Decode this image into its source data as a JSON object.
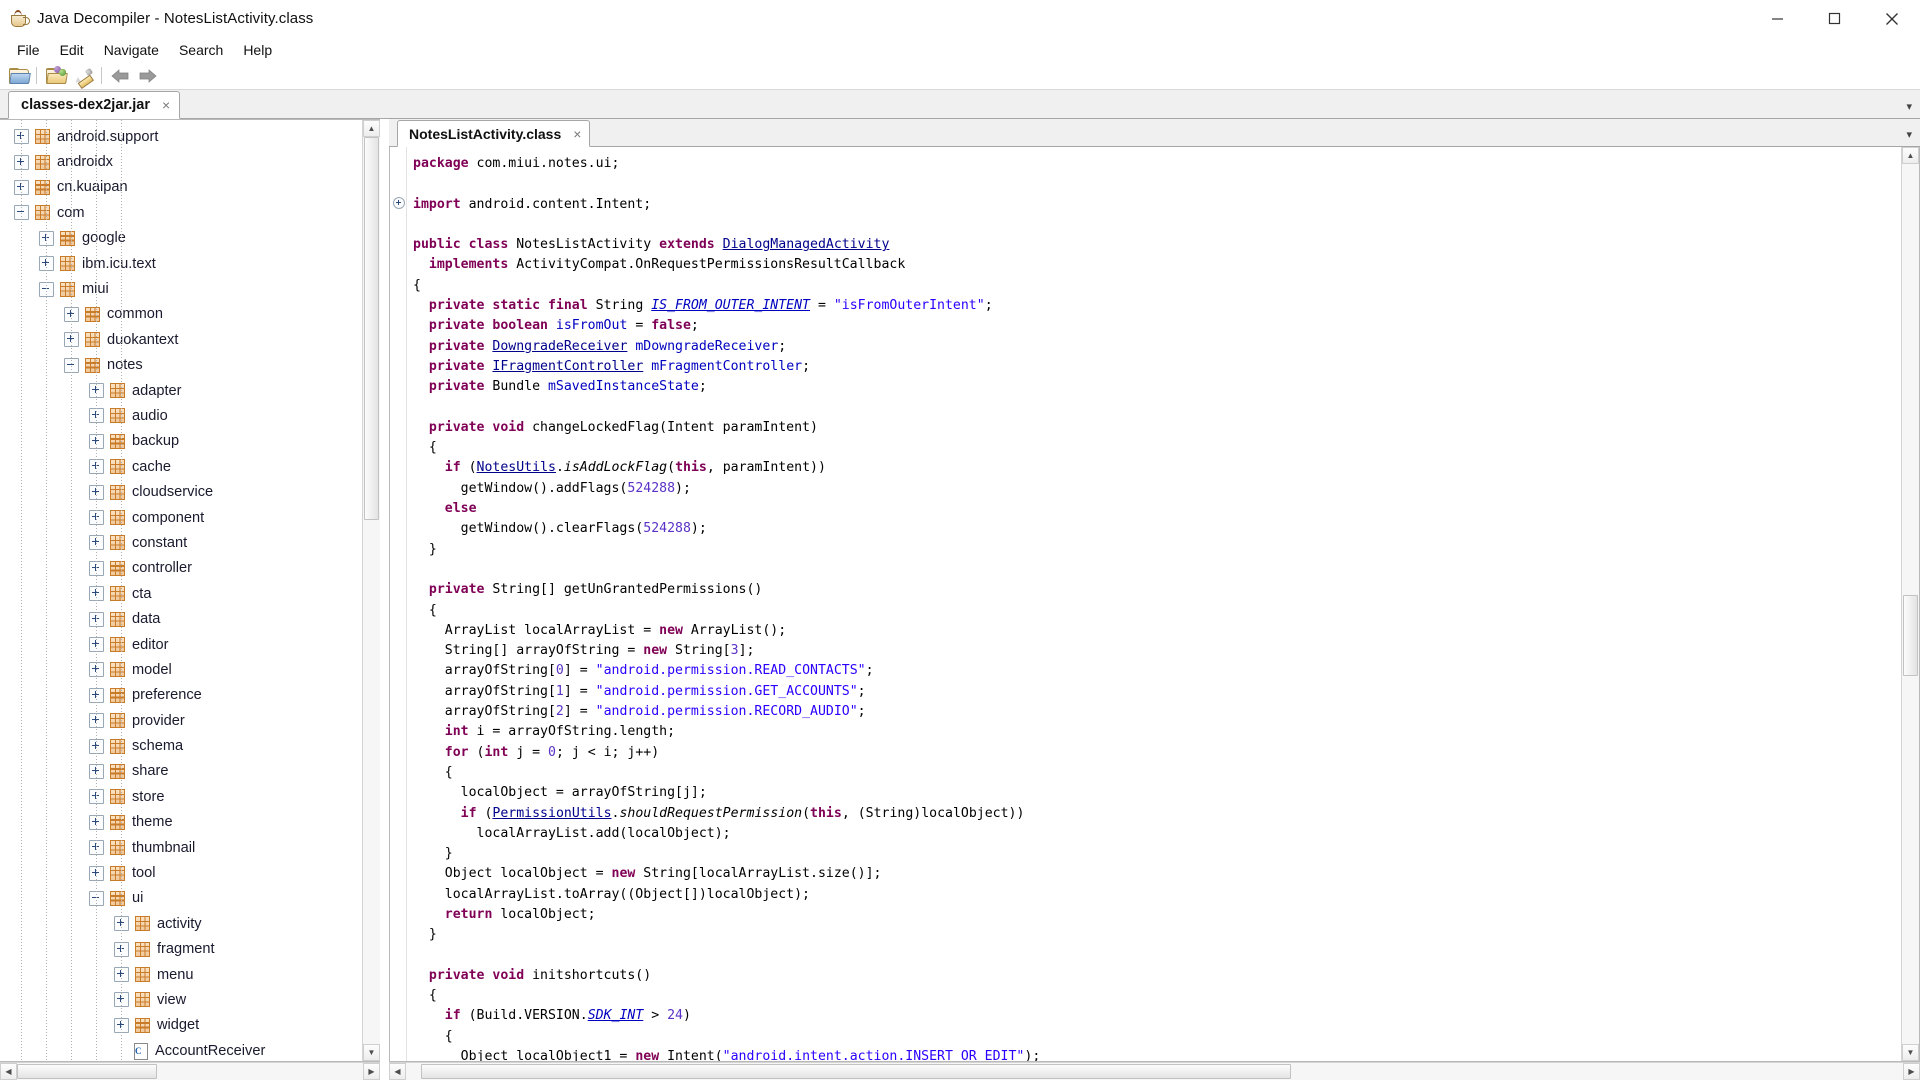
{
  "window": {
    "title": "Java Decompiler - NotesListActivity.class",
    "icon": "java-cup-icon",
    "controls": {
      "minimize": "minimize-button",
      "maximize": "maximize-button",
      "close": "close-button"
    }
  },
  "menu": {
    "items": [
      "File",
      "Edit",
      "Navigate",
      "Search",
      "Help"
    ]
  },
  "toolbar": {
    "buttons": [
      {
        "name": "open-file-icon",
        "tooltip": "Open File"
      },
      {
        "name": "open-type-icon",
        "tooltip": "Open Type"
      },
      {
        "name": "search-pencil-icon",
        "tooltip": "Open Type Hierarchy"
      },
      {
        "name": "back-arrow-icon",
        "tooltip": "Back"
      },
      {
        "name": "forward-arrow-icon",
        "tooltip": "Forward"
      }
    ]
  },
  "jar_tab": {
    "label": "classes-dex2jar.jar",
    "close": "×",
    "strip_arrow": "▾"
  },
  "tree": {
    "nodes": [
      {
        "label": "android.support",
        "depth": 0,
        "state": "collapsed",
        "icon": "package-icon"
      },
      {
        "label": "androidx",
        "depth": 0,
        "state": "collapsed",
        "icon": "package-icon"
      },
      {
        "label": "cn.kuaipan",
        "depth": 0,
        "state": "collapsed",
        "icon": "package-icon"
      },
      {
        "label": "com",
        "depth": 0,
        "state": "expanded",
        "icon": "package-icon"
      },
      {
        "label": "google",
        "depth": 1,
        "state": "collapsed",
        "icon": "package-icon"
      },
      {
        "label": "ibm.icu.text",
        "depth": 1,
        "state": "collapsed",
        "icon": "package-icon"
      },
      {
        "label": "miui",
        "depth": 1,
        "state": "expanded",
        "icon": "package-icon"
      },
      {
        "label": "common",
        "depth": 2,
        "state": "collapsed",
        "icon": "package-icon"
      },
      {
        "label": "duokantext",
        "depth": 2,
        "state": "collapsed",
        "icon": "package-icon"
      },
      {
        "label": "notes",
        "depth": 2,
        "state": "expanded",
        "icon": "package-icon"
      },
      {
        "label": "adapter",
        "depth": 3,
        "state": "collapsed",
        "icon": "package-icon"
      },
      {
        "label": "audio",
        "depth": 3,
        "state": "collapsed",
        "icon": "package-icon"
      },
      {
        "label": "backup",
        "depth": 3,
        "state": "collapsed",
        "icon": "package-icon"
      },
      {
        "label": "cache",
        "depth": 3,
        "state": "collapsed",
        "icon": "package-icon"
      },
      {
        "label": "cloudservice",
        "depth": 3,
        "state": "collapsed",
        "icon": "package-icon"
      },
      {
        "label": "component",
        "depth": 3,
        "state": "collapsed",
        "icon": "package-icon"
      },
      {
        "label": "constant",
        "depth": 3,
        "state": "collapsed",
        "icon": "package-icon"
      },
      {
        "label": "controller",
        "depth": 3,
        "state": "collapsed",
        "icon": "package-icon"
      },
      {
        "label": "cta",
        "depth": 3,
        "state": "collapsed",
        "icon": "package-icon"
      },
      {
        "label": "data",
        "depth": 3,
        "state": "collapsed",
        "icon": "package-icon"
      },
      {
        "label": "editor",
        "depth": 3,
        "state": "collapsed",
        "icon": "package-icon"
      },
      {
        "label": "model",
        "depth": 3,
        "state": "collapsed",
        "icon": "package-icon"
      },
      {
        "label": "preference",
        "depth": 3,
        "state": "collapsed",
        "icon": "package-icon"
      },
      {
        "label": "provider",
        "depth": 3,
        "state": "collapsed",
        "icon": "package-icon"
      },
      {
        "label": "schema",
        "depth": 3,
        "state": "collapsed",
        "icon": "package-icon"
      },
      {
        "label": "share",
        "depth": 3,
        "state": "collapsed",
        "icon": "package-icon"
      },
      {
        "label": "store",
        "depth": 3,
        "state": "collapsed",
        "icon": "package-icon"
      },
      {
        "label": "theme",
        "depth": 3,
        "state": "collapsed",
        "icon": "package-icon"
      },
      {
        "label": "thumbnail",
        "depth": 3,
        "state": "collapsed",
        "icon": "package-icon"
      },
      {
        "label": "tool",
        "depth": 3,
        "state": "collapsed",
        "icon": "package-icon"
      },
      {
        "label": "ui",
        "depth": 3,
        "state": "expanded",
        "icon": "package-icon"
      },
      {
        "label": "activity",
        "depth": 4,
        "state": "collapsed",
        "icon": "package-icon"
      },
      {
        "label": "fragment",
        "depth": 4,
        "state": "collapsed",
        "icon": "package-icon"
      },
      {
        "label": "menu",
        "depth": 4,
        "state": "collapsed",
        "icon": "package-icon"
      },
      {
        "label": "view",
        "depth": 4,
        "state": "collapsed",
        "icon": "package-icon"
      },
      {
        "label": "widget",
        "depth": 4,
        "state": "collapsed",
        "icon": "package-icon"
      },
      {
        "label": "AccountReceiver",
        "depth": 4,
        "state": "leaf",
        "icon": "class-file-icon"
      }
    ]
  },
  "code_tab": {
    "label": "NotesListActivity.class",
    "close": "×",
    "strip_arrow": "▾"
  },
  "code": {
    "language": "java",
    "lines": [
      [
        {
          "t": "package ",
          "c": "k"
        },
        {
          "t": "com.miui.notes.ui;",
          "c": ""
        }
      ],
      [],
      [
        {
          "t": "import ",
          "c": "k"
        },
        {
          "t": "android.content.Intent;",
          "c": ""
        }
      ],
      [],
      [
        {
          "t": "public class ",
          "c": "k"
        },
        {
          "t": "NotesListActivity ",
          "c": ""
        },
        {
          "t": "extends ",
          "c": "k"
        },
        {
          "t": "DialogManagedActivity",
          "c": "t"
        }
      ],
      [
        {
          "t": "  implements ",
          "c": "k"
        },
        {
          "t": "ActivityCompat.OnRequestPermissionsResultCallback",
          "c": ""
        }
      ],
      [
        {
          "t": "{",
          "c": ""
        }
      ],
      [
        {
          "t": "  private static final ",
          "c": "k"
        },
        {
          "t": "String ",
          "c": ""
        },
        {
          "t": "IS_FROM_OUTER_INTENT",
          "c": "sf"
        },
        {
          "t": " = ",
          "c": ""
        },
        {
          "t": "\"isFromOuterIntent\"",
          "c": "s"
        },
        {
          "t": ";",
          "c": ""
        }
      ],
      [
        {
          "t": "  private boolean ",
          "c": "k"
        },
        {
          "t": "isFromOut",
          "c": "f"
        },
        {
          "t": " = ",
          "c": ""
        },
        {
          "t": "false",
          "c": "k"
        },
        {
          "t": ";",
          "c": ""
        }
      ],
      [
        {
          "t": "  private ",
          "c": "k"
        },
        {
          "t": "DowngradeReceiver",
          "c": "t"
        },
        {
          "t": " ",
          "c": ""
        },
        {
          "t": "mDowngradeReceiver",
          "c": "f"
        },
        {
          "t": ";",
          "c": ""
        }
      ],
      [
        {
          "t": "  private ",
          "c": "k"
        },
        {
          "t": "IFragmentController",
          "c": "t"
        },
        {
          "t": " ",
          "c": ""
        },
        {
          "t": "mFragmentController",
          "c": "f"
        },
        {
          "t": ";",
          "c": ""
        }
      ],
      [
        {
          "t": "  private ",
          "c": "k"
        },
        {
          "t": "Bundle ",
          "c": ""
        },
        {
          "t": "mSavedInstanceState",
          "c": "f"
        },
        {
          "t": ";",
          "c": ""
        }
      ],
      [],
      [
        {
          "t": "  private void ",
          "c": "k"
        },
        {
          "t": "changeLockedFlag(Intent paramIntent)",
          "c": ""
        }
      ],
      [
        {
          "t": "  {",
          "c": ""
        }
      ],
      [
        {
          "t": "    ",
          "c": ""
        },
        {
          "t": "if",
          "c": "k"
        },
        {
          "t": " (",
          "c": ""
        },
        {
          "t": "NotesUtils",
          "c": "t"
        },
        {
          "t": ".",
          "c": ""
        },
        {
          "t": "isAddLockFlag",
          "c": "m"
        },
        {
          "t": "(",
          "c": ""
        },
        {
          "t": "this",
          "c": "k"
        },
        {
          "t": ", paramIntent))",
          "c": ""
        }
      ],
      [
        {
          "t": "      getWindow().addFlags(",
          "c": ""
        },
        {
          "t": "524288",
          "c": "n"
        },
        {
          "t": ");",
          "c": ""
        }
      ],
      [
        {
          "t": "    ",
          "c": ""
        },
        {
          "t": "else",
          "c": "k"
        }
      ],
      [
        {
          "t": "      getWindow().clearFlags(",
          "c": ""
        },
        {
          "t": "524288",
          "c": "n"
        },
        {
          "t": ");",
          "c": ""
        }
      ],
      [
        {
          "t": "  }",
          "c": ""
        }
      ],
      [],
      [
        {
          "t": "  private ",
          "c": "k"
        },
        {
          "t": "String[] getUnGrantedPermissions()",
          "c": ""
        }
      ],
      [
        {
          "t": "  {",
          "c": ""
        }
      ],
      [
        {
          "t": "    ArrayList localArrayList = ",
          "c": ""
        },
        {
          "t": "new",
          "c": "k"
        },
        {
          "t": " ArrayList();",
          "c": ""
        }
      ],
      [
        {
          "t": "    String[] arrayOfString = ",
          "c": ""
        },
        {
          "t": "new",
          "c": "k"
        },
        {
          "t": " String[",
          "c": ""
        },
        {
          "t": "3",
          "c": "n"
        },
        {
          "t": "];",
          "c": ""
        }
      ],
      [
        {
          "t": "    arrayOfString[",
          "c": ""
        },
        {
          "t": "0",
          "c": "n"
        },
        {
          "t": "] = ",
          "c": ""
        },
        {
          "t": "\"android.permission.READ_CONTACTS\"",
          "c": "s"
        },
        {
          "t": ";",
          "c": ""
        }
      ],
      [
        {
          "t": "    arrayOfString[",
          "c": ""
        },
        {
          "t": "1",
          "c": "n"
        },
        {
          "t": "] = ",
          "c": ""
        },
        {
          "t": "\"android.permission.GET_ACCOUNTS\"",
          "c": "s"
        },
        {
          "t": ";",
          "c": ""
        }
      ],
      [
        {
          "t": "    arrayOfString[",
          "c": ""
        },
        {
          "t": "2",
          "c": "n"
        },
        {
          "t": "] = ",
          "c": ""
        },
        {
          "t": "\"android.permission.RECORD_AUDIO\"",
          "c": "s"
        },
        {
          "t": ";",
          "c": ""
        }
      ],
      [
        {
          "t": "    ",
          "c": ""
        },
        {
          "t": "int",
          "c": "k"
        },
        {
          "t": " i = arrayOfString.length;",
          "c": ""
        }
      ],
      [
        {
          "t": "    ",
          "c": ""
        },
        {
          "t": "for",
          "c": "k"
        },
        {
          "t": " (",
          "c": ""
        },
        {
          "t": "int",
          "c": "k"
        },
        {
          "t": " j = ",
          "c": ""
        },
        {
          "t": "0",
          "c": "n"
        },
        {
          "t": "; j < i; j++)",
          "c": ""
        }
      ],
      [
        {
          "t": "    {",
          "c": ""
        }
      ],
      [
        {
          "t": "      localObject = arrayOfString[j];",
          "c": ""
        }
      ],
      [
        {
          "t": "      ",
          "c": ""
        },
        {
          "t": "if",
          "c": "k"
        },
        {
          "t": " (",
          "c": ""
        },
        {
          "t": "PermissionUtils",
          "c": "t"
        },
        {
          "t": ".",
          "c": ""
        },
        {
          "t": "shouldRequestPermission",
          "c": "m"
        },
        {
          "t": "(",
          "c": ""
        },
        {
          "t": "this",
          "c": "k"
        },
        {
          "t": ", (String)localObject))",
          "c": ""
        }
      ],
      [
        {
          "t": "        localArrayList.add(localObject);",
          "c": ""
        }
      ],
      [
        {
          "t": "    }",
          "c": ""
        }
      ],
      [
        {
          "t": "    Object localObject = ",
          "c": ""
        },
        {
          "t": "new",
          "c": "k"
        },
        {
          "t": " String[localArrayList.size()];",
          "c": ""
        }
      ],
      [
        {
          "t": "    localArrayList.toArray((Object[])localObject);",
          "c": ""
        }
      ],
      [
        {
          "t": "    ",
          "c": ""
        },
        {
          "t": "return",
          "c": "k"
        },
        {
          "t": " localObject;",
          "c": ""
        }
      ],
      [
        {
          "t": "  }",
          "c": ""
        }
      ],
      [],
      [
        {
          "t": "  private void ",
          "c": "k"
        },
        {
          "t": "initshortcuts()",
          "c": ""
        }
      ],
      [
        {
          "t": "  {",
          "c": ""
        }
      ],
      [
        {
          "t": "    ",
          "c": ""
        },
        {
          "t": "if",
          "c": "k"
        },
        {
          "t": " (Build.VERSION.",
          "c": ""
        },
        {
          "t": "SDK_INT",
          "c": "sf"
        },
        {
          "t": " > ",
          "c": ""
        },
        {
          "t": "24",
          "c": "n"
        },
        {
          "t": ")",
          "c": ""
        }
      ],
      [
        {
          "t": "    {",
          "c": ""
        }
      ],
      [
        {
          "t": "      Object localObject1 = ",
          "c": ""
        },
        {
          "t": "new",
          "c": "k"
        },
        {
          "t": " Intent(",
          "c": ""
        },
        {
          "t": "\"android.intent.action.INSERT_OR_EDIT\"",
          "c": "s"
        },
        {
          "t": ");",
          "c": ""
        }
      ]
    ]
  },
  "scrollbars": {
    "tree_vertical": {
      "up": "▲",
      "down": "▼",
      "thumb_top_pct": 0,
      "thumb_height_pct": 42
    },
    "tree_horizontal": {
      "left": "◀",
      "right": "▶",
      "thumb_left_pct": 0,
      "thumb_width_pct": 40
    },
    "code_vertical": {
      "up": "▲",
      "down": "▼",
      "thumb_top_pct": 49,
      "thumb_height_pct": 9
    },
    "code_horizontal": {
      "left": "◀",
      "right": "▶",
      "thumb_left_pct": 1,
      "thumb_width_pct": 58
    }
  },
  "colors": {
    "keyword": "#7f0055",
    "string": "#2a00ff",
    "number": "#5a32c8",
    "field": "#0000c0",
    "type_link": "#00008b",
    "package_icon": "#c87b29",
    "background": "#ffffff",
    "chrome": "#f0f0f0"
  }
}
